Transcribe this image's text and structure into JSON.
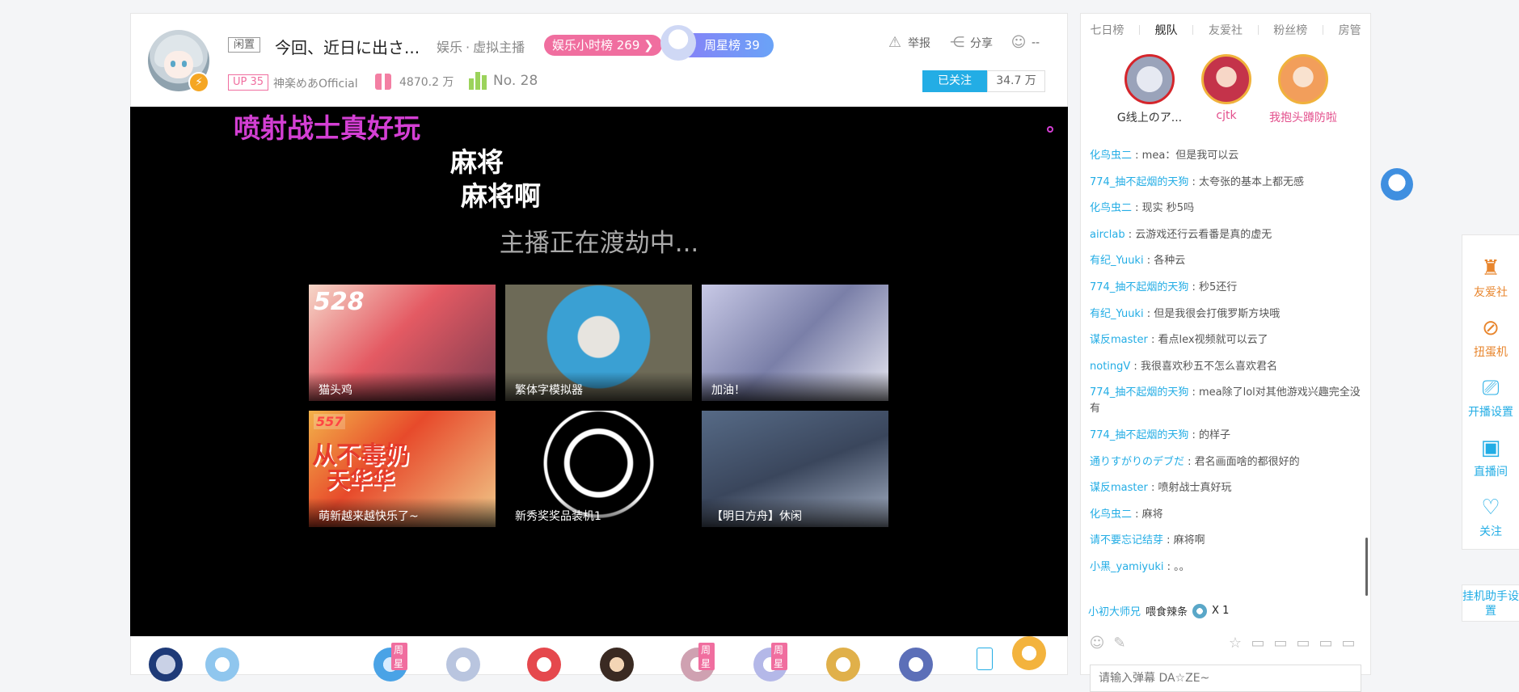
{
  "header": {
    "idle_tag": "闲置",
    "room_title": "今回、近日に出さ...",
    "category_main": "娱乐",
    "category_dot": "·",
    "category_sub": "虚拟主播",
    "hour_rank": "娱乐小时榜 269 ❯",
    "weekly_star": "周星榜 39",
    "report": "举报",
    "share": "分享",
    "more": "--",
    "up_level": "UP 35",
    "up_name": "神楽めあOfficial",
    "gift_count": "4870.2 万",
    "rank_no": "No. 28",
    "follow_label": "已关注",
    "follow_count": "34.7 万"
  },
  "player": {
    "danmaku": [
      "喷射战士真好玩",
      "麻将",
      "麻将啊"
    ],
    "offline_message": "主播正在渡劫中...",
    "recommendations": [
      {
        "number": "528",
        "title": "猫头鸡"
      },
      {
        "title": "繁体字模拟器"
      },
      {
        "title": "加油！"
      },
      {
        "number": "557",
        "banner1": "从不毒奶",
        "banner2": "天华华",
        "title": "萌新越来越快乐了~"
      },
      {
        "title": "新秀奖奖品装机1"
      },
      {
        "title": "【明日方舟】休闲"
      }
    ]
  },
  "gift_bar": {
    "tags": [
      "周星",
      "周星",
      "周星"
    ]
  },
  "side": {
    "tabs": [
      "七日榜",
      "舰队",
      "友爱社",
      "粉丝榜",
      "房管"
    ],
    "fleet": [
      {
        "name": "G线上のア..."
      },
      {
        "name": "cjtk"
      },
      {
        "name": "我抱头蹲防啦"
      }
    ],
    "chat": [
      {
        "user": "化鸟虫二",
        "text": "mea：但是我可以云"
      },
      {
        "user": "774_抽不起烟的天狗",
        "text": "太夸张的基本上都无感"
      },
      {
        "user": "化鸟虫二",
        "text": "现实 秒5吗"
      },
      {
        "user": "airclab",
        "text": "云游戏还行云看番是真的虚无"
      },
      {
        "user": "有纪_Yuuki",
        "text": "各种云"
      },
      {
        "user": "774_抽不起烟的天狗",
        "text": "秒5还行"
      },
      {
        "user": "有纪_Yuuki",
        "text": "但是我很会打俄罗斯方块哦"
      },
      {
        "user": "谋反master",
        "text": "看点lex视频就可以云了"
      },
      {
        "user": "notingV",
        "text": "我很喜欢秒五不怎么喜欢君名"
      },
      {
        "user": "774_抽不起烟的天狗",
        "text": "mea除了lol对其他游戏兴趣完全没有"
      },
      {
        "user": "774_抽不起烟的天狗",
        "text": "的样子"
      },
      {
        "user": "通りすがりのデブだ",
        "text": "君名画面啥的都很好的"
      },
      {
        "user": "谋反master",
        "text": "喷射战士真好玩"
      },
      {
        "user": "化鸟虫二",
        "text": "麻将"
      },
      {
        "user": "请不要忘记结芽",
        "text": "麻将啊"
      },
      {
        "user": "小黑_yamiyuki",
        "text": "。。"
      }
    ],
    "gift_message": {
      "sender": "小初大师兄",
      "action": "喂食辣条",
      "count": "X 1"
    },
    "input_placeholder": "请输入弹幕 DA☆ZE~"
  },
  "rail": {
    "items": [
      "友爱社",
      "扭蛋机",
      "开播设置",
      "直播间",
      "关注"
    ],
    "helper": "挂机助手设置"
  },
  "colors": {
    "accent": "#23ade5",
    "pink": "#f06e9f",
    "danmaku_purple": "#d43fd4"
  }
}
